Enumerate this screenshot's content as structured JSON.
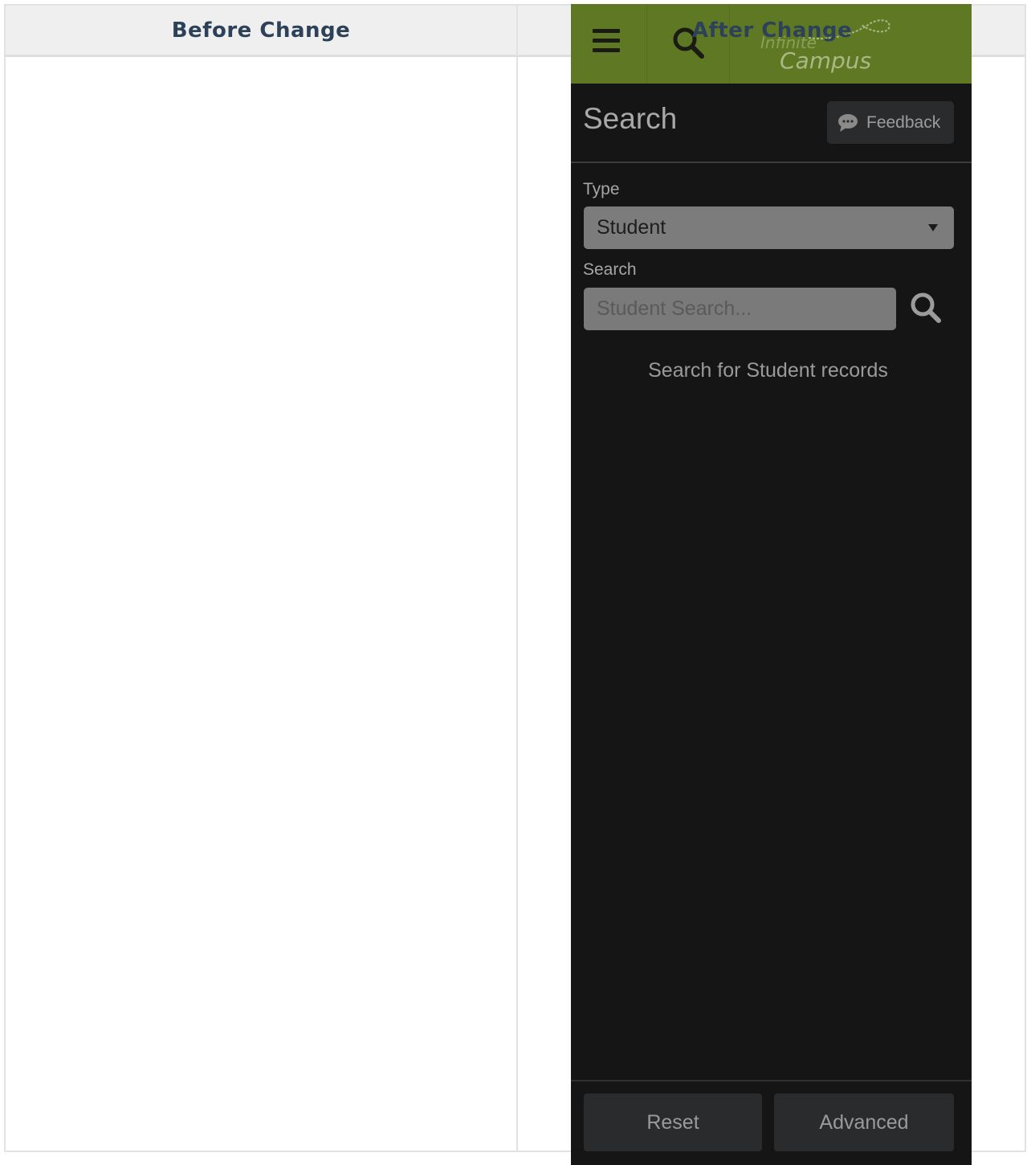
{
  "comparison": {
    "before_header": "Before Change",
    "after_header": "After Change"
  },
  "app": {
    "logo_line1": "Infinite",
    "logo_line2": "Campus",
    "header_color": "#5f7824"
  },
  "search_panel": {
    "title": "Search",
    "feedback_label": "Feedback",
    "type_label": "Type",
    "type_value": "Student",
    "search_label": "Search",
    "search_placeholder": "Student Search...",
    "empty_message": "Search for Student records",
    "reset_label": "Reset",
    "advanced_label": "Advanced"
  },
  "icons": {
    "menu": "hamburger-menu-icon",
    "search": "magnifier-icon",
    "feedback": "speech-bubble-icon",
    "dropdown": "caret-down-icon"
  }
}
